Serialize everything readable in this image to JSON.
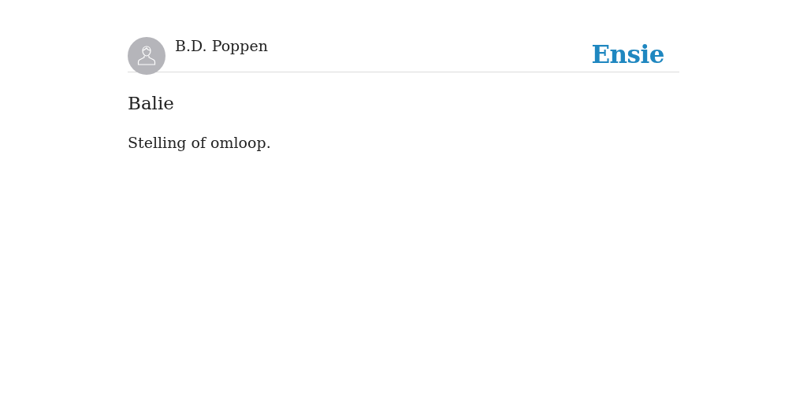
{
  "author": {
    "name": "B.D. Poppen"
  },
  "logo": "Ensie",
  "entry": {
    "title": "Balie",
    "text": "Stelling of omloop."
  }
}
